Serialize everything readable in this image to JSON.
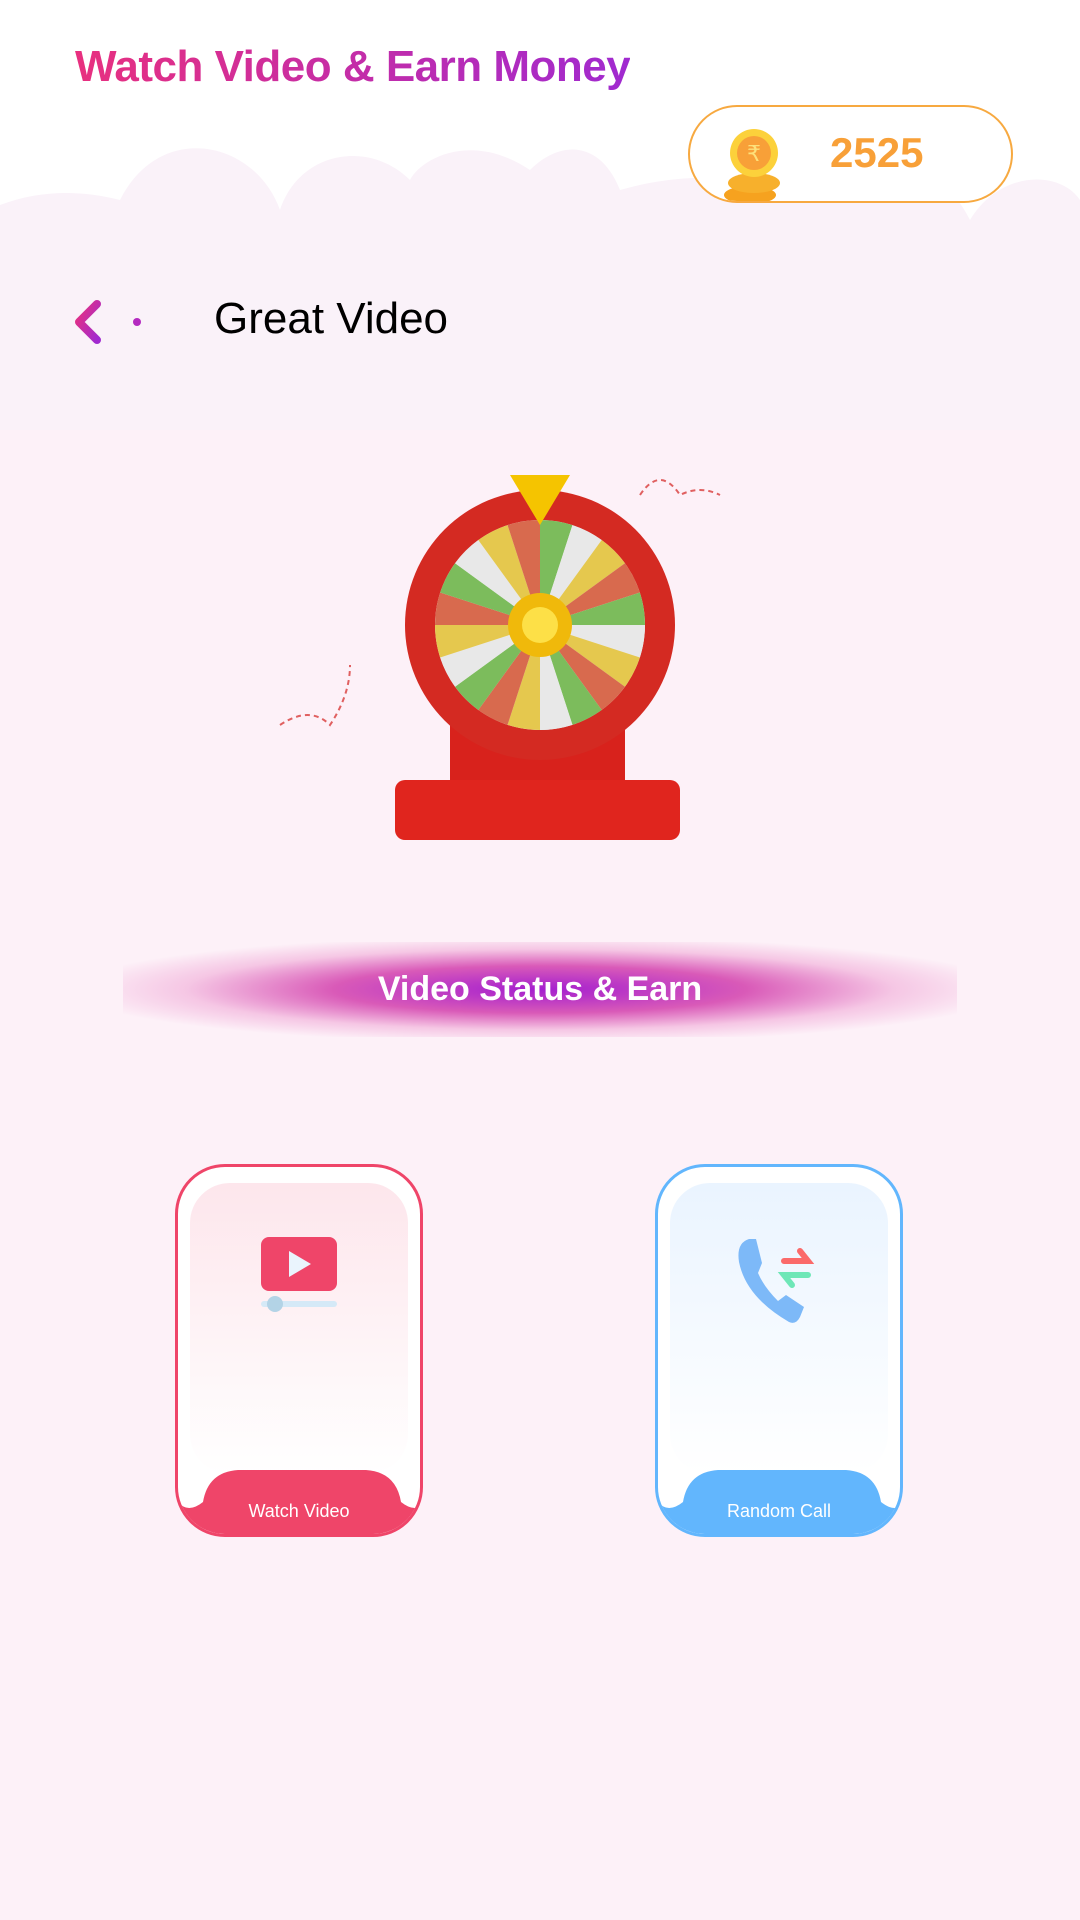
{
  "header": {
    "title": "Watch Video & Earn Money",
    "coin_balance": "2525",
    "coin_icon": "rupee-coin-stack-icon"
  },
  "page": {
    "back_icon": "arrow-left-icon",
    "title": "Great Video"
  },
  "hero": {
    "image": "spin-wheel-illustration"
  },
  "banner": {
    "label": "Video Status & Earn"
  },
  "cards": [
    {
      "label": "Watch Video",
      "icon": "play-video-icon",
      "color": "#ef4569"
    },
    {
      "label": "Random Call",
      "icon": "phone-swap-icon",
      "color": "#62b6fd"
    }
  ],
  "colors": {
    "background": "#fdf1f8",
    "accent_pink": "#e8307f",
    "accent_purple": "#a02ad0",
    "coin_orange": "#f8a038"
  }
}
